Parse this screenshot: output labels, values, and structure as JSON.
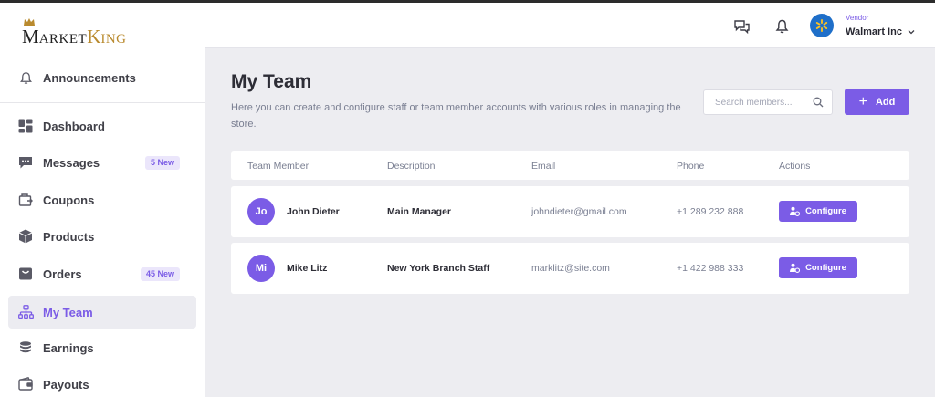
{
  "logo": {
    "m": "M",
    "arket": "ARKET",
    "k": "K",
    "ing": "ING"
  },
  "sidebar": {
    "announcements": "Announcements",
    "items": [
      {
        "label": "Dashboard",
        "icon": "dashboard-icon"
      },
      {
        "label": "Messages",
        "icon": "chat-icon",
        "badge": "5 New"
      },
      {
        "label": "Coupons",
        "icon": "coupon-icon"
      },
      {
        "label": "Products",
        "icon": "box-icon"
      },
      {
        "label": "Orders",
        "icon": "bag-icon",
        "badge": "45 New"
      },
      {
        "label": "My Team",
        "icon": "team-icon",
        "active": true
      },
      {
        "label": "Earnings",
        "icon": "coins-icon"
      },
      {
        "label": "Payouts",
        "icon": "wallet-icon"
      }
    ]
  },
  "header": {
    "vendor_label": "Vendor",
    "vendor_name": "Walmart Inc"
  },
  "page": {
    "title": "My Team",
    "description": "Here you can create and configure staff or team member accounts with various roles in managing the store.",
    "search_placeholder": "Search members...",
    "add_label": "Add"
  },
  "table": {
    "columns": [
      "Team Member",
      "Description",
      "Email",
      "Phone",
      "Actions"
    ],
    "rows": [
      {
        "initials": "Jo",
        "name": "John Dieter",
        "description": "Main Manager",
        "email": "johndieter@gmail.com",
        "phone": "+1 289 232 888",
        "action": "Configure"
      },
      {
        "initials": "Mi",
        "name": "Mike Litz",
        "description": "New York Branch Staff",
        "email": "marklitz@site.com",
        "phone": "+1 422 988 333",
        "action": "Configure"
      }
    ]
  },
  "colors": {
    "accent": "#7b5ce6",
    "sidebar_bg": "#ffffff",
    "page_bg": "#ededf1",
    "logo_gold": "#b98a2e",
    "walmart_blue": "#1f6fc9",
    "walmart_yellow": "#ffc220"
  }
}
